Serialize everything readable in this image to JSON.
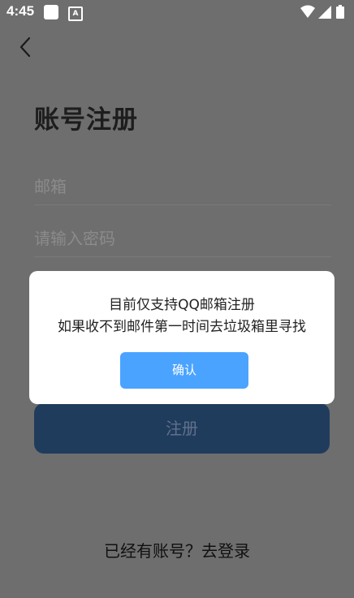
{
  "status_bar": {
    "time": "4:45",
    "icons": [
      "notification-square-icon",
      "a-badge-icon",
      "wifi-icon",
      "signal-icon",
      "battery-icon"
    ]
  },
  "header": {
    "title": "账号注册"
  },
  "form": {
    "email_placeholder": "邮箱",
    "password_placeholder": "请输入密码",
    "register_label": "注册"
  },
  "footer": {
    "login_text": "已经有账号？去登录"
  },
  "dialog": {
    "line1": "目前仅支持QQ邮箱注册",
    "line2": "如果收不到邮件第一时间去垃圾箱里寻找",
    "confirm_label": "确认"
  },
  "colors": {
    "overlay": "#6e6e6e",
    "accent": "#4aa3ff",
    "register_button": "#1f3c5d"
  }
}
